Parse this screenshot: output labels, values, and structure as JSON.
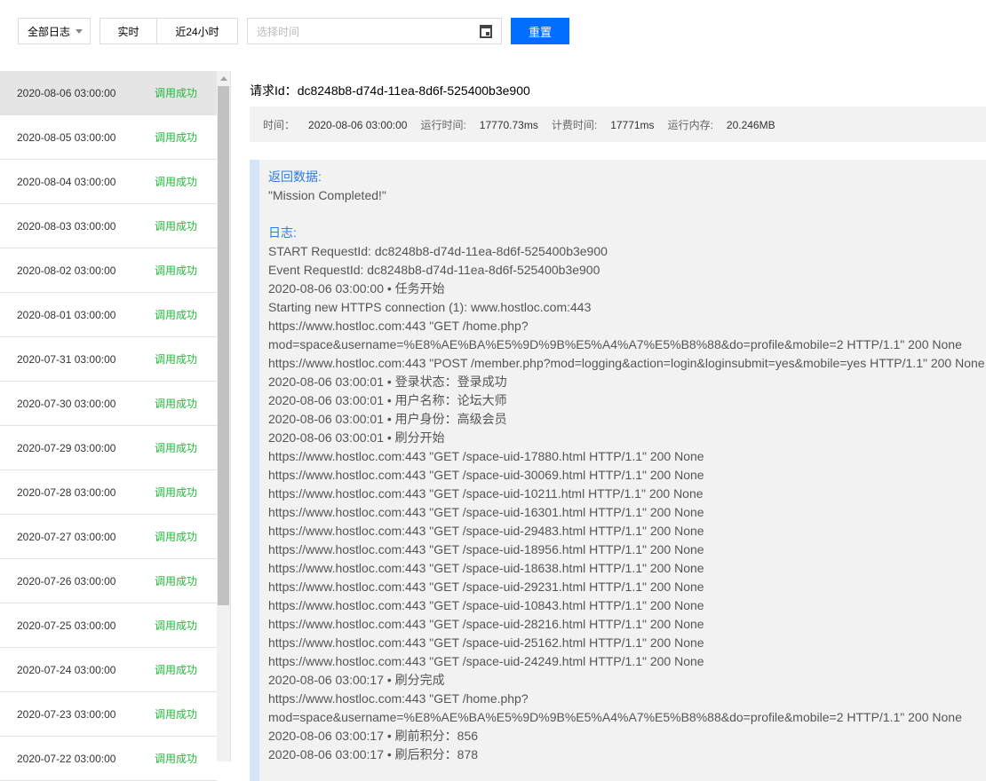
{
  "toolbar": {
    "log_filter": "全部日志",
    "realtime": "实时",
    "last24h": "近24小时",
    "date_placeholder": "选择时间",
    "reset": "重置"
  },
  "list": [
    {
      "time": "2020-08-06 03:00:00",
      "status": "调用成功"
    },
    {
      "time": "2020-08-05 03:00:00",
      "status": "调用成功"
    },
    {
      "time": "2020-08-04 03:00:00",
      "status": "调用成功"
    },
    {
      "time": "2020-08-03 03:00:00",
      "status": "调用成功"
    },
    {
      "time": "2020-08-02 03:00:00",
      "status": "调用成功"
    },
    {
      "time": "2020-08-01 03:00:00",
      "status": "调用成功"
    },
    {
      "time": "2020-07-31 03:00:00",
      "status": "调用成功"
    },
    {
      "time": "2020-07-30 03:00:00",
      "status": "调用成功"
    },
    {
      "time": "2020-07-29 03:00:00",
      "status": "调用成功"
    },
    {
      "time": "2020-07-28 03:00:00",
      "status": "调用成功"
    },
    {
      "time": "2020-07-27 03:00:00",
      "status": "调用成功"
    },
    {
      "time": "2020-07-26 03:00:00",
      "status": "调用成功"
    },
    {
      "time": "2020-07-25 03:00:00",
      "status": "调用成功"
    },
    {
      "time": "2020-07-24 03:00:00",
      "status": "调用成功"
    },
    {
      "time": "2020-07-23 03:00:00",
      "status": "调用成功"
    },
    {
      "time": "2020-07-22 03:00:00",
      "status": "调用成功"
    }
  ],
  "detail": {
    "request_id_label": "请求Id：",
    "request_id": "dc8248b8-d74d-11ea-8d6f-525400b3e900",
    "time_label": "时间：",
    "time": "2020-08-06 03:00:00",
    "run_time_label": "运行时间:",
    "run_time": "17770.73ms",
    "billed_time_label": "计费时间:",
    "billed_time": "17771ms",
    "memory_label": "运行内存:",
    "memory": "20.246MB",
    "return_label": "返回数据:",
    "return_value": "\"Mission Completed!\"",
    "log_label": "日志:",
    "log_lines": [
      "START RequestId: dc8248b8-d74d-11ea-8d6f-525400b3e900",
      "Event RequestId: dc8248b8-d74d-11ea-8d6f-525400b3e900",
      "2020-08-06 03:00:00 • 任务开始",
      "Starting new HTTPS connection (1): www.hostloc.com:443",
      "https://www.hostloc.com:443 \"GET /home.php?",
      "mod=space&username=%E8%AE%BA%E5%9D%9B%E5%A4%A7%E5%B8%88&do=profile&mobile=2 HTTP/1.1\" 200 None",
      "https://www.hostloc.com:443 \"POST /member.php?mod=logging&action=login&loginsubmit=yes&mobile=yes HTTP/1.1\" 200 None",
      "2020-08-06 03:00:01 • 登录状态：登录成功",
      "2020-08-06 03:00:01 • 用户名称：论坛大师",
      "2020-08-06 03:00:01 • 用户身份：高级会员",
      "2020-08-06 03:00:01 • 刷分开始",
      "https://www.hostloc.com:443 \"GET /space-uid-17880.html HTTP/1.1\" 200 None",
      "https://www.hostloc.com:443 \"GET /space-uid-30069.html HTTP/1.1\" 200 None",
      "https://www.hostloc.com:443 \"GET /space-uid-10211.html HTTP/1.1\" 200 None",
      "https://www.hostloc.com:443 \"GET /space-uid-16301.html HTTP/1.1\" 200 None",
      "https://www.hostloc.com:443 \"GET /space-uid-29483.html HTTP/1.1\" 200 None",
      "https://www.hostloc.com:443 \"GET /space-uid-18956.html HTTP/1.1\" 200 None",
      "https://www.hostloc.com:443 \"GET /space-uid-18638.html HTTP/1.1\" 200 None",
      "https://www.hostloc.com:443 \"GET /space-uid-29231.html HTTP/1.1\" 200 None",
      "https://www.hostloc.com:443 \"GET /space-uid-10843.html HTTP/1.1\" 200 None",
      "https://www.hostloc.com:443 \"GET /space-uid-28216.html HTTP/1.1\" 200 None",
      "https://www.hostloc.com:443 \"GET /space-uid-25162.html HTTP/1.1\" 200 None",
      "https://www.hostloc.com:443 \"GET /space-uid-24249.html HTTP/1.1\" 200 None",
      "2020-08-06 03:00:17 • 刷分完成",
      "https://www.hostloc.com:443 \"GET /home.php?",
      "mod=space&username=%E8%AE%BA%E5%9D%9B%E5%A4%A7%E5%B8%88&do=profile&mobile=2 HTTP/1.1\" 200 None",
      "2020-08-06 03:00:17 • 刷前积分：856",
      "2020-08-06 03:00:17 • 刷后积分：878"
    ]
  }
}
